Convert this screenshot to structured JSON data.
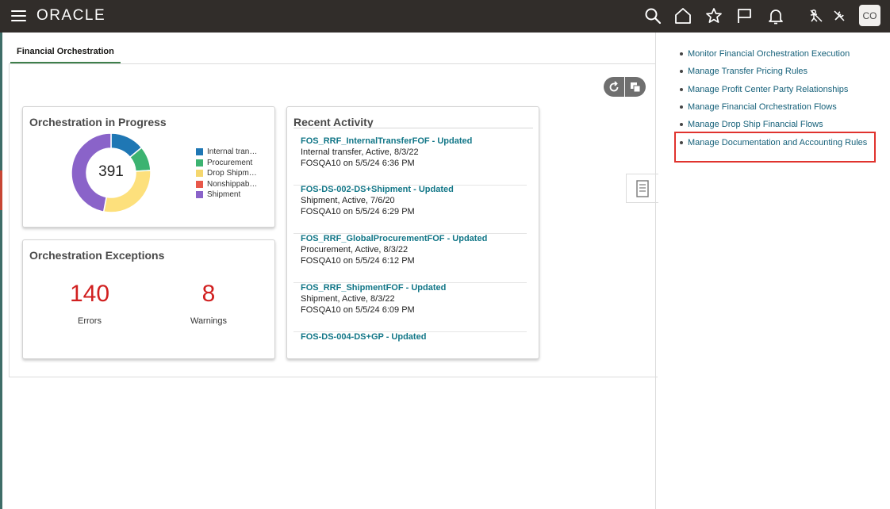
{
  "header": {
    "logo": "ORACLE",
    "user_initials": "CO",
    "icons": [
      "menu-icon",
      "search-icon",
      "home-icon",
      "star-icon",
      "flag-icon",
      "bell-icon",
      "accessibility-icon",
      "tools-icon"
    ]
  },
  "tabs": [
    {
      "label": "Financial Orchestration"
    }
  ],
  "cards": {
    "progress": {
      "title": "Orchestration in Progress",
      "total": "391",
      "legend": [
        {
          "label": "Internal tran…",
          "color": "#1f77b4"
        },
        {
          "label": "Procurement",
          "color": "#3cb371"
        },
        {
          "label": "Drop Shipm…",
          "color": "#f5d76e"
        },
        {
          "label": "Nonshippab…",
          "color": "#e8584a"
        },
        {
          "label": "Shipment",
          "color": "#8a63c9"
        }
      ],
      "donut": [
        {
          "name": "Internal tran…",
          "fraction": 0.14,
          "color": "#1f77b4"
        },
        {
          "name": "Procurement",
          "fraction": 0.1,
          "color": "#3cb371"
        },
        {
          "name": "Drop Shipm…",
          "fraction": 0.29,
          "color": "#fde07c"
        },
        {
          "name": "Nonshippab…",
          "fraction": 0.0,
          "color": "#e8584a"
        },
        {
          "name": "Shipment",
          "fraction": 0.47,
          "color": "#8a63c9"
        }
      ]
    },
    "exceptions": {
      "title": "Orchestration Exceptions",
      "errors_value": "140",
      "errors_label": "Errors",
      "warnings_value": "8",
      "warnings_label": "Warnings"
    },
    "activity": {
      "title": "Recent Activity",
      "items": [
        {
          "title": "FOS_RRF_InternalTransferFOF - Updated",
          "detail": "Internal transfer, Active, 8/3/22",
          "meta": "FOSQA10 on 5/5/24 6:36 PM"
        },
        {
          "title": "FOS-DS-002-DS+Shipment - Updated",
          "detail": "Shipment, Active, 7/6/20",
          "meta": "FOSQA10 on 5/5/24 6:29 PM"
        },
        {
          "title": "FOS_RRF_GlobalProcurementFOF - Updated",
          "detail": "Procurement, Active, 8/3/22",
          "meta": "FOSQA10 on 5/5/24 6:12 PM"
        },
        {
          "title": "FOS_RRF_ShipmentFOF - Updated",
          "detail": "Shipment, Active, 8/3/22",
          "meta": "FOSQA10 on 5/5/24 6:09 PM"
        },
        {
          "title": "FOS-DS-004-DS+GP - Updated",
          "detail": "",
          "meta": ""
        }
      ]
    }
  },
  "tasks": [
    {
      "label": "Monitor Financial Orchestration Execution"
    },
    {
      "label": "Manage Transfer Pricing Rules"
    },
    {
      "label": "Manage Profit Center Party Relationships"
    },
    {
      "label": "Manage Financial Orchestration Flows"
    },
    {
      "label": "Manage Drop Ship Financial Flows"
    },
    {
      "label": "Manage Documentation and Accounting Rules"
    }
  ],
  "highlighted_task": "Manage Documentation and Accounting Rules"
}
